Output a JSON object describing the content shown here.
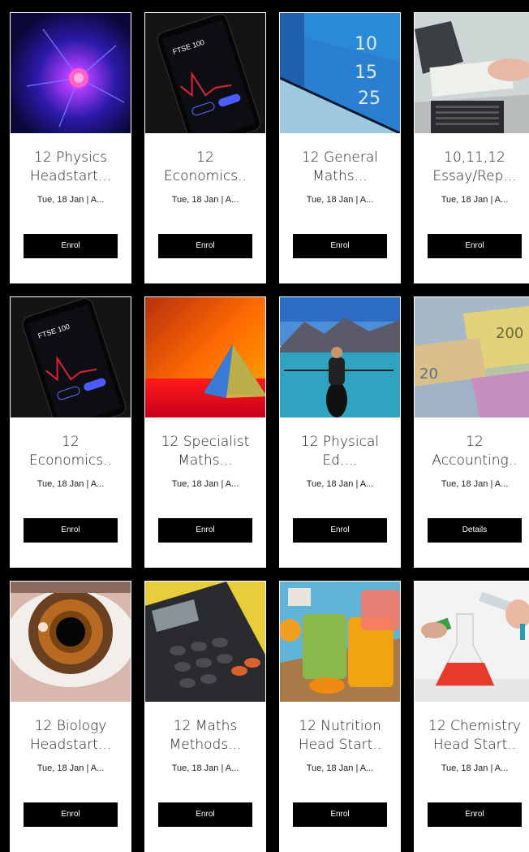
{
  "courses": [
    {
      "title_line1": "12 Physics",
      "title_line2": "Headstart...",
      "date": "Tue, 18 Jan | A...",
      "button": "Enrol",
      "image": "plasma-ball"
    },
    {
      "title_line1": "12",
      "title_line2": "Economics..",
      "date": "Tue, 18 Jan | A...",
      "button": "Enrol",
      "image": "phone-stock-app"
    },
    {
      "title_line1": "12 General",
      "title_line2": "Maths...",
      "date": "Tue, 18 Jan | A...",
      "button": "Enrol",
      "image": "handwritten-numbers"
    },
    {
      "title_line1": "10,11,12",
      "title_line2": "Essay/Rep...",
      "date": "Tue, 18 Jan | A...",
      "button": "Enrol",
      "image": "laptop-writing"
    },
    {
      "title_line1": "12",
      "title_line2": "Economics..",
      "date": "Tue, 18 Jan | A...",
      "button": "Enrol",
      "image": "phone-stock-app"
    },
    {
      "title_line1": "12 Specialist",
      "title_line2": "Maths...",
      "date": "Tue, 18 Jan | A...",
      "button": "Enrol",
      "image": "prism"
    },
    {
      "title_line1": "12 Physical",
      "title_line2": "Ed....",
      "date": "Tue, 18 Jan | A...",
      "button": "Enrol",
      "image": "kayak-lake"
    },
    {
      "title_line1": "12",
      "title_line2": "Accounting..",
      "date": "Tue, 18 Jan | A...",
      "button": "Details",
      "image": "euro-banknotes"
    },
    {
      "title_line1": "12 Biology",
      "title_line2": "Headstart...",
      "date": "Tue, 18 Jan | A...",
      "button": "Enrol",
      "image": "eye-closeup"
    },
    {
      "title_line1": "12 Maths",
      "title_line2": "Methods...",
      "date": "Tue, 18 Jan | A...",
      "button": "Enrol",
      "image": "calculator"
    },
    {
      "title_line1": "12 Nutrition",
      "title_line2": "Head Start..",
      "date": "Tue, 18 Jan | A...",
      "button": "Enrol",
      "image": "juice-glasses"
    },
    {
      "title_line1": "12 Chemistry",
      "title_line2": "Head Start..",
      "date": "Tue, 18 Jan | A...",
      "button": "Enrol",
      "image": "chemistry-flask"
    }
  ]
}
